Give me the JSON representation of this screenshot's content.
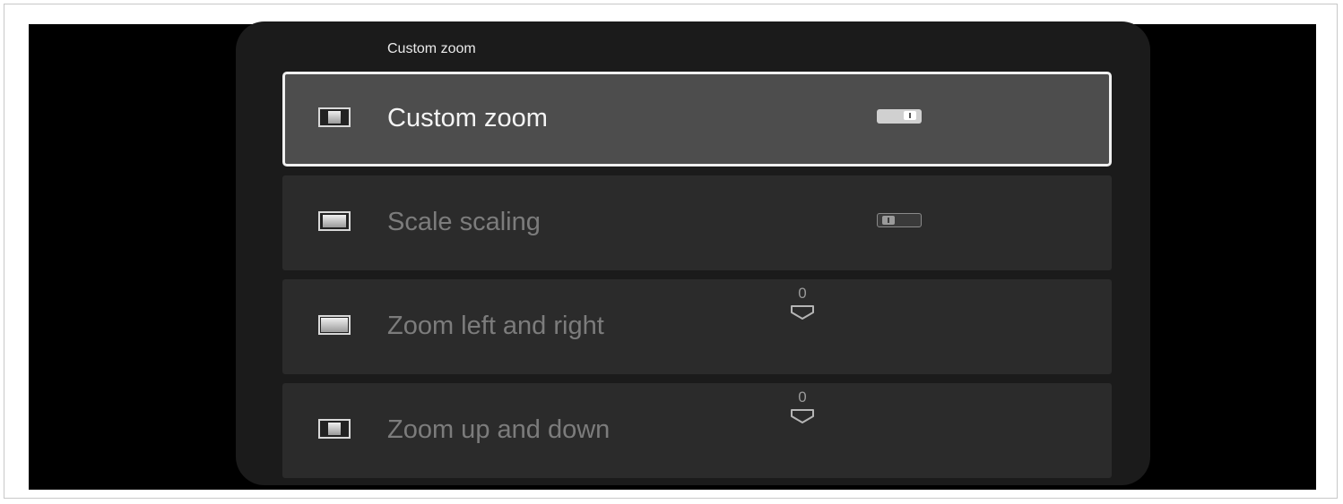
{
  "panel": {
    "title": "Custom zoom"
  },
  "items": [
    {
      "label": "Custom zoom",
      "icon": "zoom-square-icon",
      "control": "toggle",
      "toggle_on": true,
      "focused": true
    },
    {
      "label": "Scale scaling",
      "icon": "scale-wide-icon",
      "control": "toggle",
      "toggle_on": false,
      "focused": false
    },
    {
      "label": "Zoom left and right",
      "icon": "zoom-full-icon",
      "control": "slider",
      "value": "0",
      "focused": false
    },
    {
      "label": "Zoom up and down",
      "icon": "zoom-square-icon",
      "control": "slider",
      "value": "0",
      "focused": false
    }
  ],
  "colors": {
    "panel_bg": "#1b1b1b",
    "item_bg": "#2b2b2b",
    "focused_bg": "#4d4d4d",
    "focused_border": "#f0f0f0"
  }
}
